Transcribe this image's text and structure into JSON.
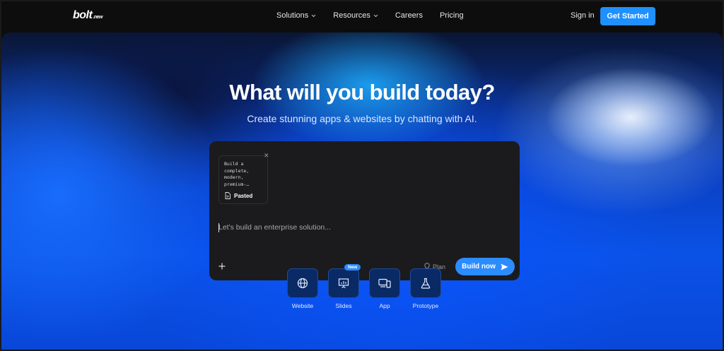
{
  "brand": {
    "name": "bolt",
    "suffix": ".new"
  },
  "nav": {
    "items": [
      {
        "label": "Solutions",
        "has_dropdown": true
      },
      {
        "label": "Resources",
        "has_dropdown": true
      },
      {
        "label": "Careers",
        "has_dropdown": false
      },
      {
        "label": "Pricing",
        "has_dropdown": false
      }
    ],
    "sign_in": "Sign in",
    "get_started": "Get Started"
  },
  "hero": {
    "title": "What will you build today?",
    "subtitle": "Create stunning apps & websites by chatting with AI."
  },
  "prompt": {
    "pasted_preview": "Build a\ncomplete,\nmodern,\npremium-…",
    "pasted_label": "Pasted",
    "placeholder": "Let's build an enterprise solution...",
    "plan_label": "Plan",
    "build_label": "Build now"
  },
  "tiles": [
    {
      "label": "Website",
      "icon": "globe-icon"
    },
    {
      "label": "Slides",
      "icon": "presentation-icon",
      "badge": "New"
    },
    {
      "label": "App",
      "icon": "devices-icon"
    },
    {
      "label": "Prototype",
      "icon": "flask-icon"
    }
  ],
  "colors": {
    "accent": "#2b8cff",
    "cta": "#1e90ff",
    "box": "#1b1b1d"
  }
}
